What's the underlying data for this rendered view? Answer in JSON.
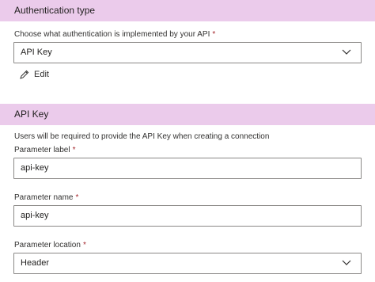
{
  "auth_section": {
    "title": "Authentication type",
    "auth_label": "Choose what authentication is implemented by your API",
    "auth_required_mark": "*",
    "auth_value": "API Key",
    "edit_label": "Edit"
  },
  "apikey_section": {
    "title": "API Key",
    "description": "Users will be required to provide the API Key when creating a connection",
    "param_label_label": "Parameter label",
    "param_label_value": "api-key",
    "param_name_label": "Parameter name",
    "param_name_value": "api-key",
    "param_location_label": "Parameter location",
    "param_location_value": "Header",
    "required_mark": "*"
  },
  "icons": {
    "edit": "pencil-icon",
    "dropdown": "chevron-down-icon"
  },
  "colors": {
    "section_header_bg": "#ebcbeb",
    "required": "#a4262c",
    "border": "#8a8886"
  }
}
